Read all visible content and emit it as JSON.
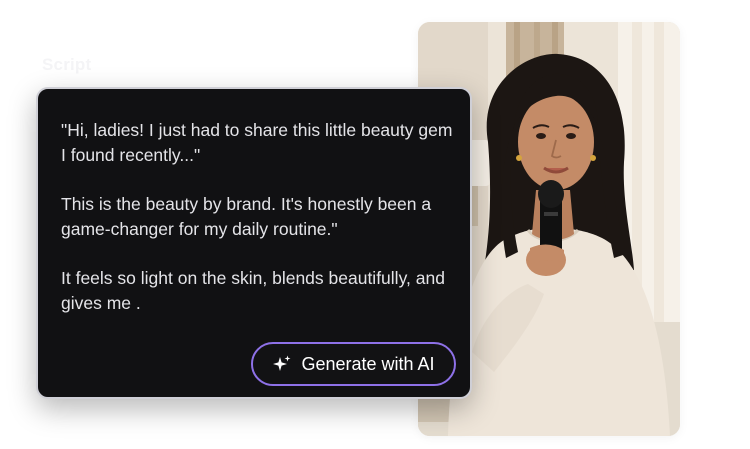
{
  "section_label": "Script",
  "script": {
    "paragraphs": [
      "\"Hi, ladies! I just had to share this little beauty gem I found recently...\"",
      "This is the beauty by brand. It's honestly been a game-changer for my daily routine.\"",
      "It feels so light on the skin, blends beautifully, and gives me ."
    ]
  },
  "generate_button": {
    "label": "Generate with AI",
    "icon": "sparkles-icon",
    "border_color": "#8e71e8"
  },
  "colors": {
    "card_background": "#111113",
    "card_border": "#cfcfd6",
    "text": "#e4e4e8"
  }
}
